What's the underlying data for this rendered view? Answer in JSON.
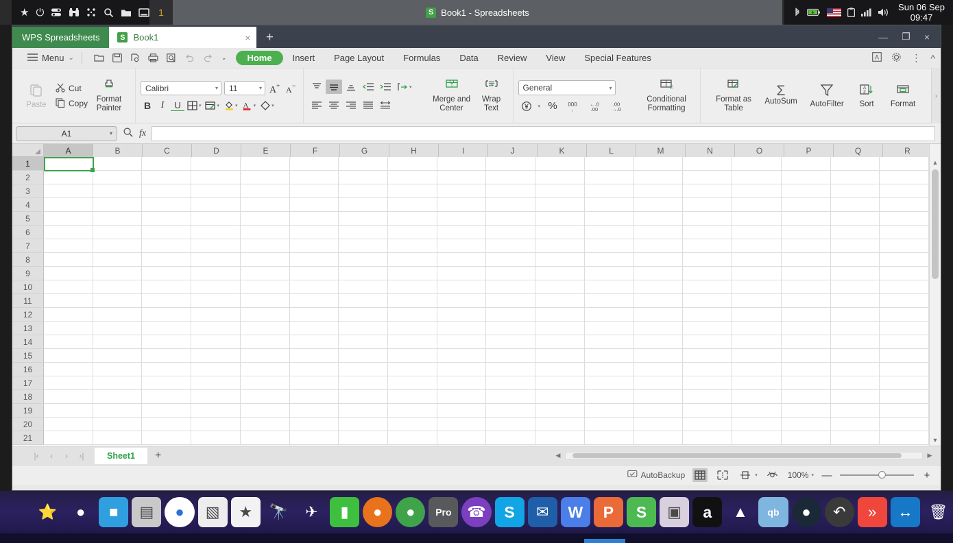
{
  "system_bar": {
    "left_icons": [
      "star-icon",
      "power-icon",
      "toggle-icon",
      "binoculars-icon",
      "dots-icon",
      "search-icon",
      "folder-icon",
      "window-icon"
    ],
    "workspace": "1",
    "window_title": "Book1 - Spreadsheets",
    "title_icon": "S",
    "right_icons": [
      "bluetooth-icon",
      "battery-icon",
      "flag-icon",
      "clipboard-icon",
      "signal-icon",
      "volume-icon"
    ],
    "date": "Sun 06 Sep",
    "time": "09:47"
  },
  "tabstrip": {
    "brand": "WPS Spreadsheets",
    "doc_tab": "Book1",
    "doc_tab_icon": "S",
    "close_label": "×",
    "new_tab_label": "+",
    "minimize": "—",
    "restore": "❐",
    "close": "×"
  },
  "menurow": {
    "menu_label": "Menu",
    "menu_caret": "⌄",
    "quick_icons": [
      "open-icon",
      "save-icon",
      "save-as-icon",
      "print-icon",
      "print-preview-icon",
      "undo-icon",
      "redo-icon",
      "customize-icon"
    ],
    "tabs": [
      {
        "label": "Home",
        "active": true
      },
      {
        "label": "Insert",
        "active": false
      },
      {
        "label": "Page Layout",
        "active": false
      },
      {
        "label": "Formulas",
        "active": false
      },
      {
        "label": "Data",
        "active": false
      },
      {
        "label": "Review",
        "active": false
      },
      {
        "label": "View",
        "active": false
      },
      {
        "label": "Special Features",
        "active": false
      }
    ],
    "right_icons": [
      "a-box-icon",
      "gear-icon",
      "more-icon",
      "collapse-ribbon-icon"
    ]
  },
  "ribbon": {
    "paste": "Paste",
    "cut": "Cut",
    "copy": "Copy",
    "format_painter": "Format\nPainter",
    "format_painter_l1": "Format",
    "format_painter_l2": "Painter",
    "font_name": "Calibri",
    "font_size": "11",
    "grow_font": "A⁺",
    "shrink_font": "A⁻",
    "bold": "B",
    "italic": "I",
    "underline": "U",
    "merge_l1": "Merge and",
    "merge_l2": "Center",
    "wrap_l1": "Wrap",
    "wrap_l2": "Text",
    "number_format": "General",
    "percent": "%",
    "comma": "000",
    "inc_dec_label": "←.0",
    "dec_dec_label": ".00",
    "cond_l1": "Conditional",
    "cond_l2": "Formatting",
    "fmt_table_l1": "Format as",
    "fmt_table_l2": "Table",
    "autosum": "AutoSum",
    "autofilter": "AutoFilter",
    "sort": "Sort",
    "format": "Format",
    "overflow": "›"
  },
  "formula_bar": {
    "name_box": "A1",
    "search_icon": "search-icon",
    "fx": "fx",
    "formula_value": "",
    "formula_placeholder": ""
  },
  "grid": {
    "columns": [
      "A",
      "B",
      "C",
      "D",
      "E",
      "F",
      "G",
      "H",
      "I",
      "J",
      "K",
      "L",
      "M",
      "N",
      "O",
      "P",
      "Q",
      "R"
    ],
    "rows": [
      "1",
      "2",
      "3",
      "4",
      "5",
      "6",
      "7",
      "8",
      "9",
      "10",
      "11",
      "12",
      "13",
      "14",
      "15",
      "16",
      "17",
      "18",
      "19",
      "20",
      "21"
    ],
    "selected_cell": "A1",
    "selected_column": "A",
    "selected_row": "1"
  },
  "sheetbar": {
    "nav_first": "|‹",
    "nav_prev": "‹",
    "nav_next": "›",
    "nav_last": "›|",
    "sheets": [
      "Sheet1"
    ],
    "add_sheet": "+"
  },
  "statusbar": {
    "autobackup": "AutoBackup",
    "views": [
      "normal-view-icon",
      "page-break-icon",
      "page-layout-icon",
      "reading-layout-icon"
    ],
    "zoom": "100%",
    "zoom_out": "—",
    "zoom_in": "+"
  },
  "dock": {
    "items": [
      {
        "name": "smiley-star-icon",
        "glyph": "⭐",
        "bg": "transparent"
      },
      {
        "name": "bubbles-icon",
        "glyph": "●",
        "bg": "transparent"
      },
      {
        "name": "window-manager-icon",
        "glyph": "■",
        "bg": "#2f9fe0"
      },
      {
        "name": "file-cabinet-icon",
        "glyph": "▤",
        "bg": "#c9c9c9"
      },
      {
        "name": "settings-toggles-icon",
        "glyph": "●",
        "bg": "#ffffff"
      },
      {
        "name": "color-palette-icon",
        "glyph": "▧",
        "bg": "#ededed"
      },
      {
        "name": "app-store-icon",
        "glyph": "★",
        "bg": "#f2f2f2"
      },
      {
        "name": "binoculars-icon",
        "glyph": "🔭",
        "bg": "transparent"
      },
      {
        "name": "rocket-icon",
        "glyph": "✈",
        "bg": "transparent"
      },
      {
        "name": "green-pipe-icon",
        "glyph": "▮",
        "bg": "#3fbf3f"
      },
      {
        "name": "firefox-icon",
        "glyph": "●",
        "bg": "#e8731c"
      },
      {
        "name": "chrome-icon",
        "glyph": "●",
        "bg": "#3fa34a"
      },
      {
        "name": "opera-pro-icon",
        "glyph": "Pro",
        "bg": "#58595b"
      },
      {
        "name": "viber-icon",
        "glyph": "☎",
        "bg": "#7b3fbf"
      },
      {
        "name": "skype-icon",
        "glyph": "S",
        "bg": "#12a5e6"
      },
      {
        "name": "thunderbird-icon",
        "glyph": "✉",
        "bg": "#1f5ea8"
      },
      {
        "name": "wps-writer-icon",
        "glyph": "W",
        "bg": "#4b7ee8"
      },
      {
        "name": "wps-presentation-icon",
        "glyph": "P",
        "bg": "#ea6a38"
      },
      {
        "name": "wps-spreadsheets-icon",
        "glyph": "S",
        "bg": "#4cba50"
      },
      {
        "name": "image-viewer-icon",
        "glyph": "▣",
        "bg": "#d9d0de"
      },
      {
        "name": "audacity-icon",
        "glyph": "a",
        "bg": "#111111"
      },
      {
        "name": "vlc-icon",
        "glyph": "▲",
        "bg": "transparent"
      },
      {
        "name": "qbittorrent-icon",
        "glyph": "qb",
        "bg": "#7fb6e0"
      },
      {
        "name": "steam-icon",
        "glyph": "●",
        "bg": "#1b2838"
      },
      {
        "name": "undo-app-icon",
        "glyph": "↶",
        "bg": "#3a3a3a"
      },
      {
        "name": "double-chevron-icon",
        "glyph": "»",
        "bg": "#f0473c"
      },
      {
        "name": "teamviewer-icon",
        "glyph": "↔",
        "bg": "#1878c8"
      },
      {
        "name": "trash-icon",
        "glyph": "🗑",
        "bg": "transparent"
      }
    ]
  }
}
